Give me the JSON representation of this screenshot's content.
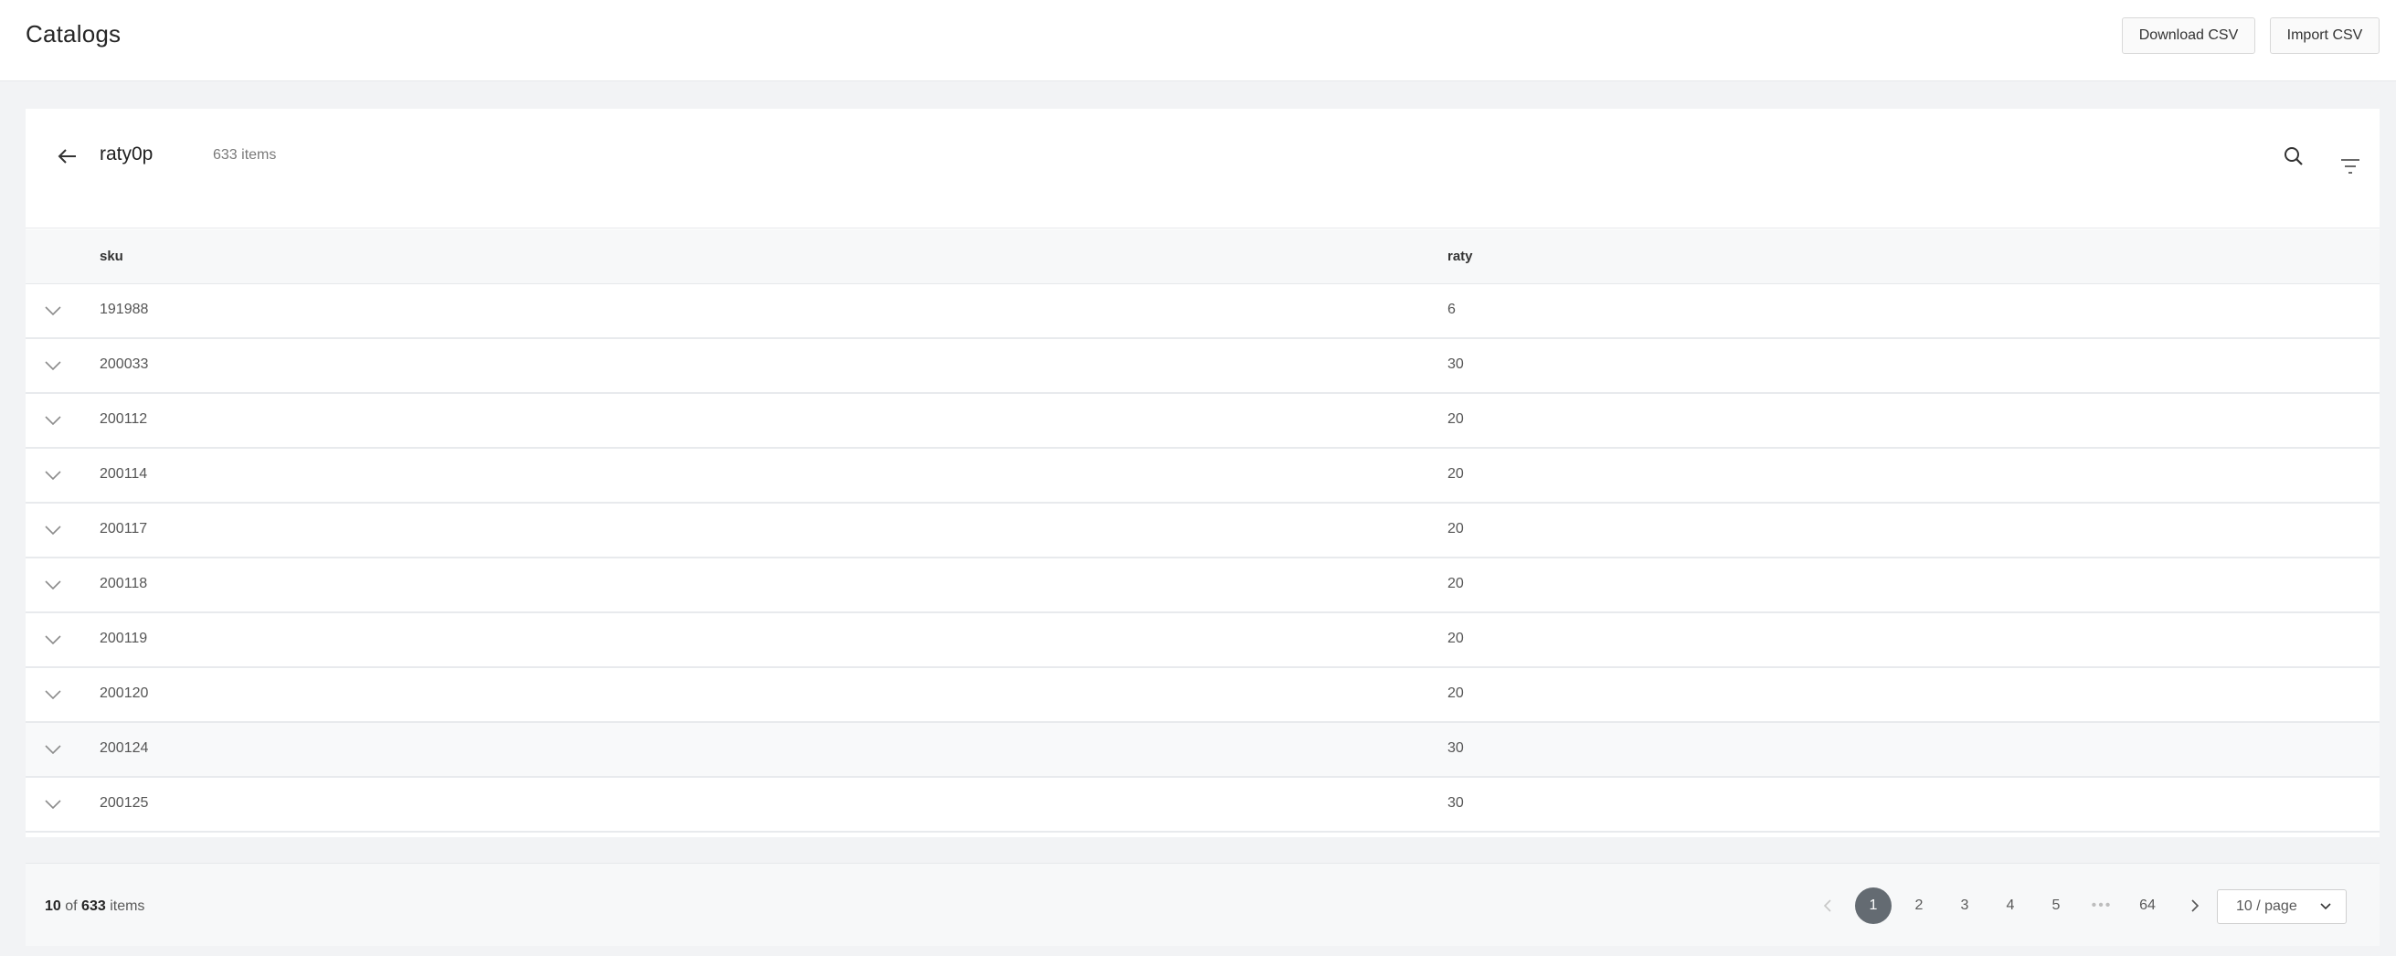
{
  "header": {
    "title": "Catalogs",
    "download_label": "Download CSV",
    "import_label": "Import CSV"
  },
  "catalog": {
    "name": "raty0p",
    "items_count_label": "633 items"
  },
  "table": {
    "columns": [
      "sku",
      "raty"
    ],
    "rows": [
      {
        "sku": "191988",
        "raty": "6"
      },
      {
        "sku": "200033",
        "raty": "30"
      },
      {
        "sku": "200112",
        "raty": "20"
      },
      {
        "sku": "200114",
        "raty": "20"
      },
      {
        "sku": "200117",
        "raty": "20"
      },
      {
        "sku": "200118",
        "raty": "20"
      },
      {
        "sku": "200119",
        "raty": "20"
      },
      {
        "sku": "200120",
        "raty": "20"
      },
      {
        "sku": "200124",
        "raty": "30"
      },
      {
        "sku": "200125",
        "raty": "30"
      }
    ]
  },
  "footer": {
    "shown": "10",
    "of_label": "of",
    "total": "633",
    "items_label": "items",
    "pages": [
      "1",
      "2",
      "3",
      "4",
      "5"
    ],
    "ellipsis": "•••",
    "last_page": "64",
    "current_page": "1",
    "page_size_label": "10 / page"
  },
  "icons": {
    "back": "arrow-left-icon",
    "search": "search-icon",
    "filter": "filter-icon",
    "expand": "chevron-down-icon",
    "prev": "chevron-left-icon",
    "next": "chevron-right-icon"
  },
  "colors": {
    "active_page": "#646b72",
    "background": "#f2f3f5"
  }
}
